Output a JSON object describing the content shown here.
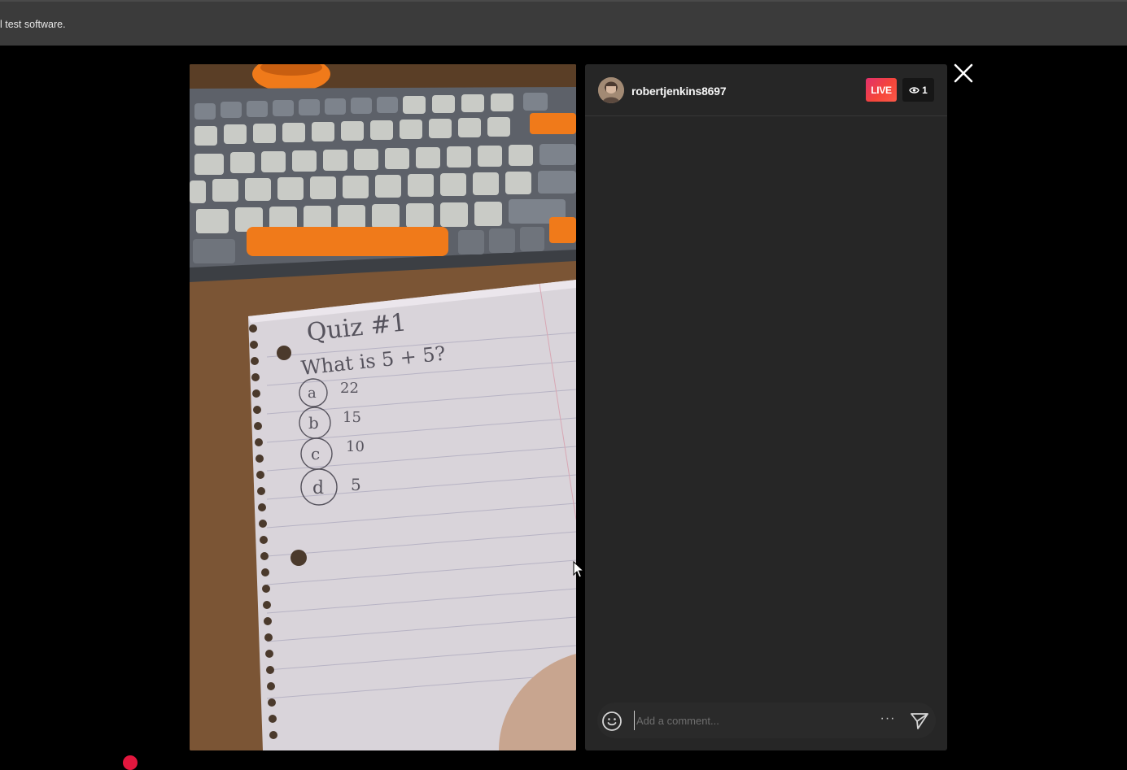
{
  "infobar": {
    "text": "l test software."
  },
  "video": {
    "description_icon": "live-video-frame",
    "notebook_lines": [
      "Quiz #1",
      "What is  5 + 5?",
      "a",
      "22",
      "b",
      "15",
      "c",
      "10",
      "d",
      "5"
    ]
  },
  "header": {
    "username": "robertjenkins8697",
    "live_label": "LIVE",
    "viewer_count": "1"
  },
  "comment": {
    "placeholder": "Add a comment...",
    "more_label": "···"
  },
  "colors": {
    "live_gradient_start": "#e1306c",
    "live_gradient_end": "#fd5949",
    "panel_bg": "#262626",
    "infobar_bg": "#3b3b3b"
  }
}
